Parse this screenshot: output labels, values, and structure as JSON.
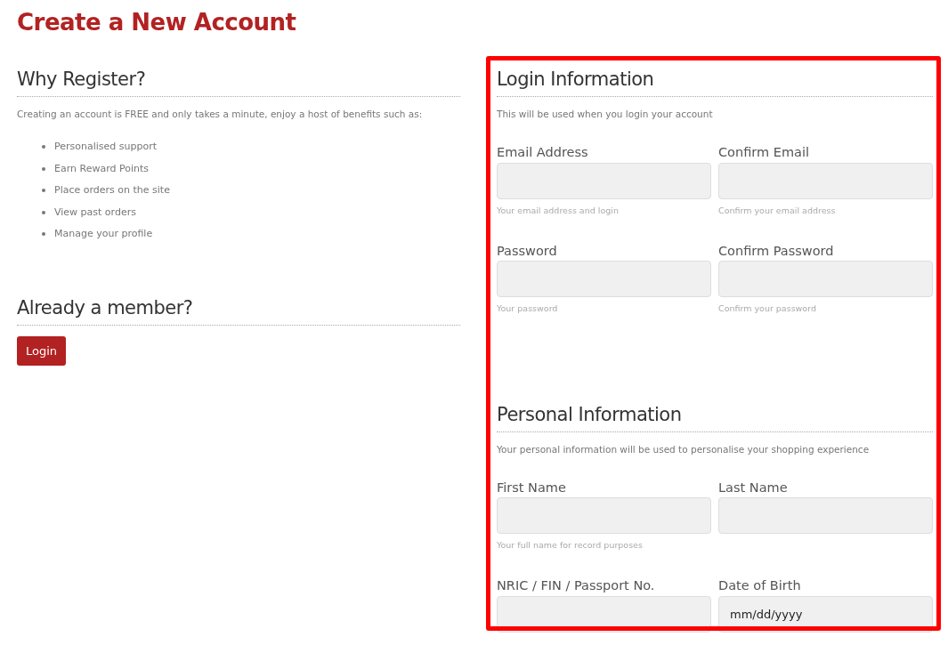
{
  "page_title": "Create a New Account",
  "why_register": {
    "heading": "Why Register?",
    "intro": "Creating an account is FREE and only takes a minute, enjoy a host of benefits such as:",
    "benefits": [
      "Personalised support",
      "Earn Reward Points",
      "Place orders on the site",
      "View past orders",
      "Manage your profile"
    ]
  },
  "already_member": {
    "heading": "Already a member?",
    "button": "Login"
  },
  "sections": [
    {
      "heading": "Login Information",
      "description": "This will be used when you login your account",
      "fields": [
        {
          "label": "Email Address",
          "help": "Your email address and login"
        },
        {
          "label": "Confirm Email",
          "help": "Confirm your email address"
        },
        {
          "label": "Password",
          "help": "Your password"
        },
        {
          "label": "Confirm Password",
          "help": "Confirm your password"
        }
      ]
    },
    {
      "heading": "Personal Information",
      "description": "Your personal information will be used to personalise your shopping experience",
      "fields": [
        {
          "label": "First Name",
          "help": "Your full name for record purposes"
        },
        {
          "label": "Last Name"
        },
        {
          "label": "NRIC / FIN / Passport No."
        },
        {
          "label": "Date of Birth",
          "placeholder": "mm/dd/yyyy"
        }
      ]
    }
  ],
  "highlight": {
    "shown": true
  }
}
